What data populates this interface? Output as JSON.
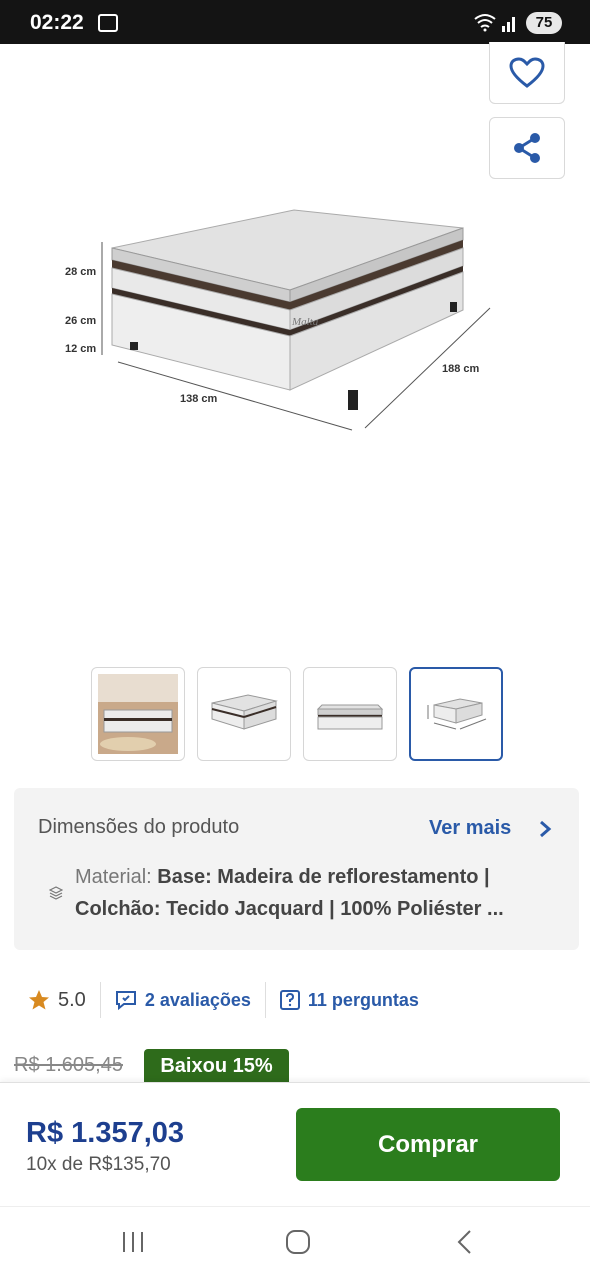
{
  "status_bar": {
    "time": "02:22",
    "battery": "75"
  },
  "product_image": {
    "height_labels": [
      "28 cm",
      "26 cm",
      "12 cm"
    ],
    "width_label": "138 cm",
    "length_label": "188 cm",
    "brand": "Malta"
  },
  "thumbnails": {
    "count": 4,
    "active_index": 3
  },
  "specs": {
    "title": "Dimensões do produto",
    "more_label": "Ver mais",
    "material_label": "Material:",
    "material_line1": "Base: Madeira de reflorestamento |",
    "material_line2": "Colchão: Tecido Jacquard | 100% Poliéster ..."
  },
  "stats": {
    "rating": "5.0",
    "reviews": "2 avaliações",
    "questions": "11 perguntas"
  },
  "pricing": {
    "old_price": "R$ 1.605,45",
    "discount_badge": "Baixou 15%",
    "price": "R$ 1.357,03",
    "installments": "10x de R$135,70",
    "buy_label": "Comprar"
  },
  "colors": {
    "primary_blue": "#2a5aa8",
    "buy_green": "#2b7d1d",
    "badge_green": "#2e6b1b",
    "star": "#d88a20"
  }
}
